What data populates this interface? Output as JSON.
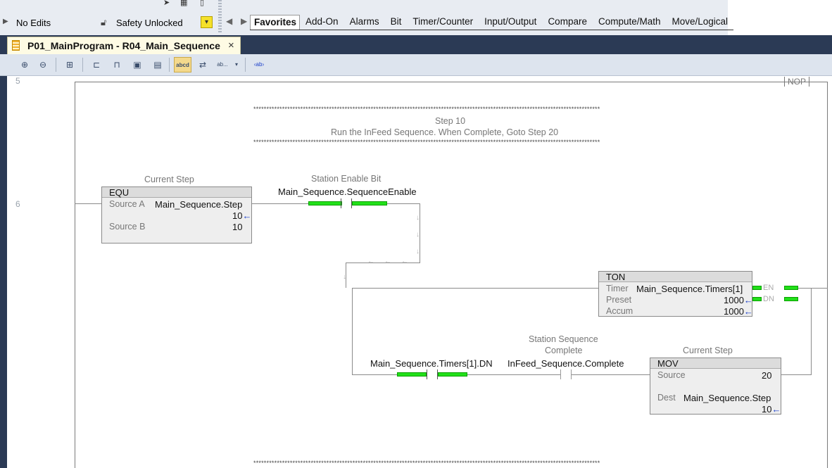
{
  "top": {
    "no_edits": "No Edits",
    "safety": "Safety Unlocked",
    "instruction_tabs": [
      "Favorites",
      "Add-On",
      "Alarms",
      "Bit",
      "Timer/Counter",
      "Input/Output",
      "Compare",
      "Compute/Math",
      "Move/Logical"
    ]
  },
  "document_tab": {
    "title": "P01_MainProgram - R04_Main_Sequence",
    "close": "×"
  },
  "toolbar": {
    "buttons": [
      "zoom-in-icon",
      "zoom-out-icon",
      "routine-icon",
      "rung-icon",
      "branch-icon",
      "instruction-icon",
      "element-icon",
      "abcd-icon",
      "text-replace-icon",
      "ab-dropdown-icon",
      "ab-tag-icon"
    ],
    "abcd_label": "abcd",
    "ab_label": "ab...",
    "abtag_label": "‹ab›"
  },
  "rungs": {
    "prev_num": "5",
    "prev_nop": "NOP",
    "rung6_num": "6",
    "stars": "*************************************************************************************************************************************",
    "comment_line1": "Step 10",
    "comment_line2": "Run the InFeed Sequence.  When Complete, Goto Step 20",
    "equ": {
      "desc": "Current Step",
      "name": "EQU",
      "source_a_label": "Source A",
      "source_a_tag": "Main_Sequence.Step",
      "source_a_value": "10",
      "source_b_label": "Source B",
      "source_b_value": "10"
    },
    "xic1": {
      "desc": "Station Enable Bit",
      "tag": "Main_Sequence.SequenceEnable"
    },
    "ton": {
      "name": "TON",
      "timer_label": "Timer",
      "timer_tag": "Main_Sequence.Timers[1]",
      "preset_label": "Preset",
      "preset_value": "1000",
      "accum_label": "Accum",
      "accum_value": "1000",
      "en": "EN",
      "dn": "DN"
    },
    "xic2": {
      "tag": "Main_Sequence.Timers[1].DN"
    },
    "xic3": {
      "desc1": "Station Sequence",
      "desc2": "Complete",
      "tag": "InFeed_Sequence.Complete"
    },
    "mov": {
      "desc": "Current Step",
      "name": "MOV",
      "source_label": "Source",
      "source_value": "20",
      "dest_label": "Dest",
      "dest_tag": "Main_Sequence.Step",
      "dest_value": "10"
    }
  }
}
